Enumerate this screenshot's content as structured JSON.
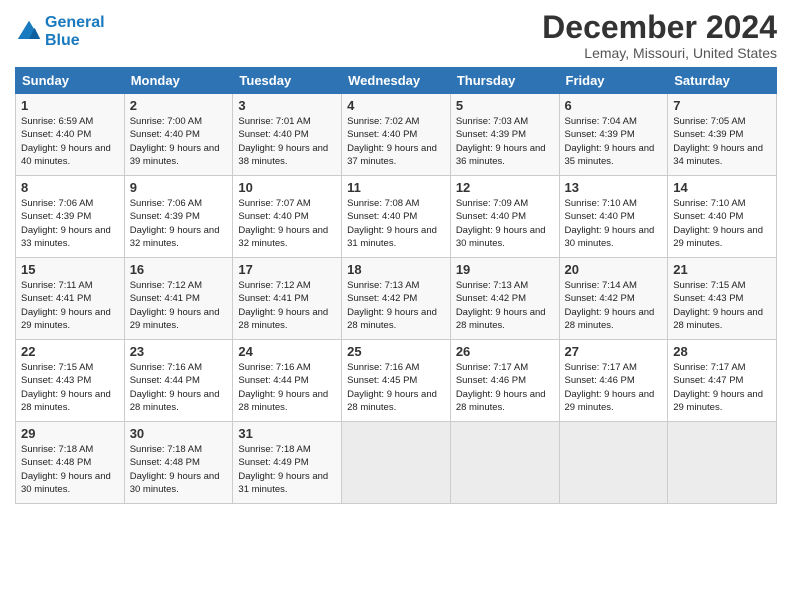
{
  "header": {
    "logo_line1": "General",
    "logo_line2": "Blue",
    "month_title": "December 2024",
    "location": "Lemay, Missouri, United States"
  },
  "weekdays": [
    "Sunday",
    "Monday",
    "Tuesday",
    "Wednesday",
    "Thursday",
    "Friday",
    "Saturday"
  ],
  "weeks": [
    [
      {
        "day": "1",
        "sunrise": "6:59 AM",
        "sunset": "4:40 PM",
        "daylight": "9 hours and 40 minutes."
      },
      {
        "day": "2",
        "sunrise": "7:00 AM",
        "sunset": "4:40 PM",
        "daylight": "9 hours and 39 minutes."
      },
      {
        "day": "3",
        "sunrise": "7:01 AM",
        "sunset": "4:40 PM",
        "daylight": "9 hours and 38 minutes."
      },
      {
        "day": "4",
        "sunrise": "7:02 AM",
        "sunset": "4:40 PM",
        "daylight": "9 hours and 37 minutes."
      },
      {
        "day": "5",
        "sunrise": "7:03 AM",
        "sunset": "4:39 PM",
        "daylight": "9 hours and 36 minutes."
      },
      {
        "day": "6",
        "sunrise": "7:04 AM",
        "sunset": "4:39 PM",
        "daylight": "9 hours and 35 minutes."
      },
      {
        "day": "7",
        "sunrise": "7:05 AM",
        "sunset": "4:39 PM",
        "daylight": "9 hours and 34 minutes."
      }
    ],
    [
      {
        "day": "8",
        "sunrise": "7:06 AM",
        "sunset": "4:39 PM",
        "daylight": "9 hours and 33 minutes."
      },
      {
        "day": "9",
        "sunrise": "7:06 AM",
        "sunset": "4:39 PM",
        "daylight": "9 hours and 32 minutes."
      },
      {
        "day": "10",
        "sunrise": "7:07 AM",
        "sunset": "4:40 PM",
        "daylight": "9 hours and 32 minutes."
      },
      {
        "day": "11",
        "sunrise": "7:08 AM",
        "sunset": "4:40 PM",
        "daylight": "9 hours and 31 minutes."
      },
      {
        "day": "12",
        "sunrise": "7:09 AM",
        "sunset": "4:40 PM",
        "daylight": "9 hours and 30 minutes."
      },
      {
        "day": "13",
        "sunrise": "7:10 AM",
        "sunset": "4:40 PM",
        "daylight": "9 hours and 30 minutes."
      },
      {
        "day": "14",
        "sunrise": "7:10 AM",
        "sunset": "4:40 PM",
        "daylight": "9 hours and 29 minutes."
      }
    ],
    [
      {
        "day": "15",
        "sunrise": "7:11 AM",
        "sunset": "4:41 PM",
        "daylight": "9 hours and 29 minutes."
      },
      {
        "day": "16",
        "sunrise": "7:12 AM",
        "sunset": "4:41 PM",
        "daylight": "9 hours and 29 minutes."
      },
      {
        "day": "17",
        "sunrise": "7:12 AM",
        "sunset": "4:41 PM",
        "daylight": "9 hours and 28 minutes."
      },
      {
        "day": "18",
        "sunrise": "7:13 AM",
        "sunset": "4:42 PM",
        "daylight": "9 hours and 28 minutes."
      },
      {
        "day": "19",
        "sunrise": "7:13 AM",
        "sunset": "4:42 PM",
        "daylight": "9 hours and 28 minutes."
      },
      {
        "day": "20",
        "sunrise": "7:14 AM",
        "sunset": "4:42 PM",
        "daylight": "9 hours and 28 minutes."
      },
      {
        "day": "21",
        "sunrise": "7:15 AM",
        "sunset": "4:43 PM",
        "daylight": "9 hours and 28 minutes."
      }
    ],
    [
      {
        "day": "22",
        "sunrise": "7:15 AM",
        "sunset": "4:43 PM",
        "daylight": "9 hours and 28 minutes."
      },
      {
        "day": "23",
        "sunrise": "7:16 AM",
        "sunset": "4:44 PM",
        "daylight": "9 hours and 28 minutes."
      },
      {
        "day": "24",
        "sunrise": "7:16 AM",
        "sunset": "4:44 PM",
        "daylight": "9 hours and 28 minutes."
      },
      {
        "day": "25",
        "sunrise": "7:16 AM",
        "sunset": "4:45 PM",
        "daylight": "9 hours and 28 minutes."
      },
      {
        "day": "26",
        "sunrise": "7:17 AM",
        "sunset": "4:46 PM",
        "daylight": "9 hours and 28 minutes."
      },
      {
        "day": "27",
        "sunrise": "7:17 AM",
        "sunset": "4:46 PM",
        "daylight": "9 hours and 29 minutes."
      },
      {
        "day": "28",
        "sunrise": "7:17 AM",
        "sunset": "4:47 PM",
        "daylight": "9 hours and 29 minutes."
      }
    ],
    [
      {
        "day": "29",
        "sunrise": "7:18 AM",
        "sunset": "4:48 PM",
        "daylight": "9 hours and 30 minutes."
      },
      {
        "day": "30",
        "sunrise": "7:18 AM",
        "sunset": "4:48 PM",
        "daylight": "9 hours and 30 minutes."
      },
      {
        "day": "31",
        "sunrise": "7:18 AM",
        "sunset": "4:49 PM",
        "daylight": "9 hours and 31 minutes."
      },
      null,
      null,
      null,
      null
    ]
  ]
}
